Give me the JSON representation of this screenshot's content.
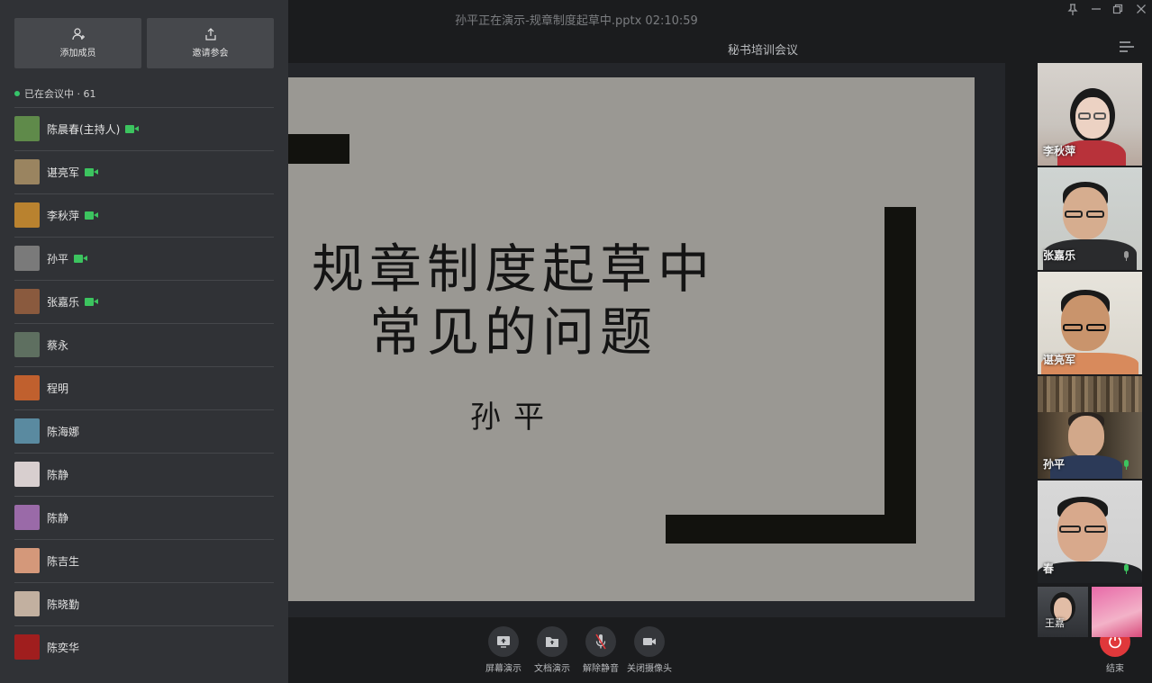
{
  "window": {
    "title": "孙平正在演示-规章制度起草中.pptx 02:10:59",
    "meeting_name": "秘书培训会议"
  },
  "sidebar": {
    "add_member_label": "添加成员",
    "invite_label": "邀请参会",
    "status_text": "已在会议中 · 61",
    "participants": [
      {
        "name": "陈晨春(主持人)",
        "camera": true,
        "avatar_color": "#5f8a4a"
      },
      {
        "name": "谌亮军",
        "camera": true,
        "avatar_color": "#9a8460"
      },
      {
        "name": "李秋萍",
        "camera": true,
        "avatar_color": "#b9822f"
      },
      {
        "name": "孙平",
        "camera": true,
        "avatar_color": "#7a7a7a"
      },
      {
        "name": "张嘉乐",
        "camera": true,
        "avatar_color": "#8a5a3e"
      },
      {
        "name": "蔡永",
        "camera": false,
        "avatar_color": "#5e6f60"
      },
      {
        "name": "程明",
        "camera": false,
        "avatar_color": "#c0602e"
      },
      {
        "name": "陈海娜",
        "camera": false,
        "avatar_color": "#5a8aa0"
      },
      {
        "name": "陈静",
        "camera": false,
        "avatar_color": "#d8cfcf"
      },
      {
        "name": "陈静",
        "camera": false,
        "avatar_color": "#9a6aa8"
      },
      {
        "name": "陈吉生",
        "camera": false,
        "avatar_color": "#d4987a"
      },
      {
        "name": "陈晓勤",
        "camera": false,
        "avatar_color": "#c2b0a0"
      },
      {
        "name": "陈奕华",
        "camera": false,
        "avatar_color": "#a01e1e"
      }
    ]
  },
  "slide": {
    "title_line1": "规章制度起草中",
    "title_line2": "常见的问题",
    "author": "孙平"
  },
  "controls": {
    "screen_share": "屏幕演示",
    "doc_share": "文档演示",
    "unmute": "解除静音",
    "close_camera": "关闭摄像头",
    "end": "结束"
  },
  "videos": [
    {
      "name": "李秋萍",
      "mic": "none"
    },
    {
      "name": "张嘉乐",
      "mic": "muted"
    },
    {
      "name": "谌亮军",
      "mic": "none"
    },
    {
      "name": "孙平",
      "mic": "active"
    },
    {
      "name": "春",
      "mic": "active"
    }
  ],
  "small_videos": [
    {
      "name": "王嘉"
    }
  ],
  "colors": {
    "accent_green": "#3cc45f",
    "end_red": "#e0383b"
  }
}
